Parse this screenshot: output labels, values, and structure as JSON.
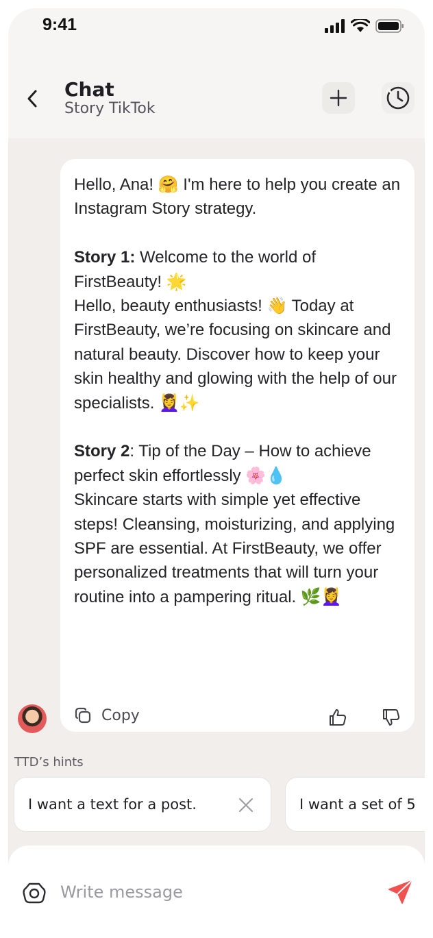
{
  "status": {
    "time": "9:41"
  },
  "header": {
    "title": "Chat",
    "subtitle": "Story TikTok"
  },
  "message": {
    "p1": "Hello, Ana! 🤗 I'm here to help you create an Instagram Story strategy.",
    "s1_label": "Story 1:",
    "s1_title": " Welcome to the world of FirstBeauty! 🌟",
    "s1_body": "Hello, beauty enthusiasts! 👋 Today at FirstBeauty, we’re focusing on skincare and natural beauty. Discover how to keep your skin healthy and glowing with the help of our specialists. 💆‍♀️✨",
    "s2_label": "Story 2",
    "s2_title": ": Tip of the Day – How to achieve perfect skin effortlessly 🌸💧",
    "s2_body": "Skincare starts with simple yet effective steps! Cleansing, moisturizing, and applying SPF are essential. At FirstBeauty, we offer personalized treatments that will turn your routine into a pampering ritual. 🌿💆‍♀️",
    "copy_label": "Copy"
  },
  "hints": {
    "label": "TTD’s hints",
    "items": [
      "I want a text for a post.",
      "I want a set of 5"
    ]
  },
  "composer": {
    "placeholder": "Write message"
  },
  "colors": {
    "accent": "#f0524f",
    "background": "#f1eeec",
    "card": "#ffffff"
  }
}
